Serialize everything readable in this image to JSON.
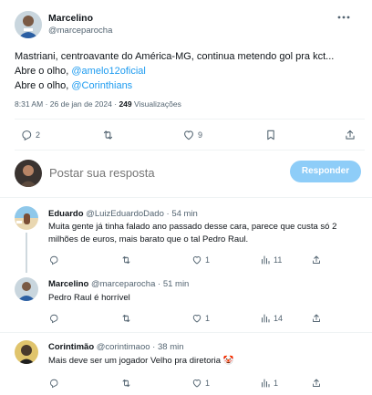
{
  "main_tweet": {
    "author_name": "Marcelino",
    "author_handle": "@marceparocha",
    "line1": "Mastriani, centroavante do América-MG, continua metendo gol pra kct...",
    "line2_prefix": "Abre o olho, ",
    "line2_mention": "@amelo12oficial",
    "line3_prefix": "Abre o olho, ",
    "line3_mention": "@Corinthians",
    "time": "8:31 AM",
    "date": "26 de jan de 2024",
    "views_count": "249",
    "views_label": "Visualizações",
    "replies": "2",
    "likes": "9"
  },
  "compose": {
    "placeholder": "Postar sua resposta",
    "button_label": "Responder"
  },
  "replies": [
    {
      "name": "Eduardo",
      "handle": "@LuizEduardoDado",
      "time": "54 min",
      "line1": "Muita gente já tinha falado ano passado desse cara, parece que custa só 2",
      "line2": "milhões de euros, mais barato que o tal Pedro Raul.",
      "likes": "1",
      "views": "11"
    },
    {
      "name": "Marcelino",
      "handle": "@marceparocha",
      "time": "51 min",
      "line1": "Pedro Raul é horrível",
      "likes": "1",
      "views": "14"
    },
    {
      "name": "Corintimão",
      "handle": "@corintimaoo",
      "time": "38 min",
      "line1": "Mais deve ser um jogador Velho pra diretoria",
      "emoji": "🤡",
      "likes": "1",
      "views": "1"
    }
  ],
  "separator": "·",
  "colors": {
    "accent": "#1d9bf0",
    "button_disabled": "#8ecdf8",
    "muted": "#536471"
  }
}
